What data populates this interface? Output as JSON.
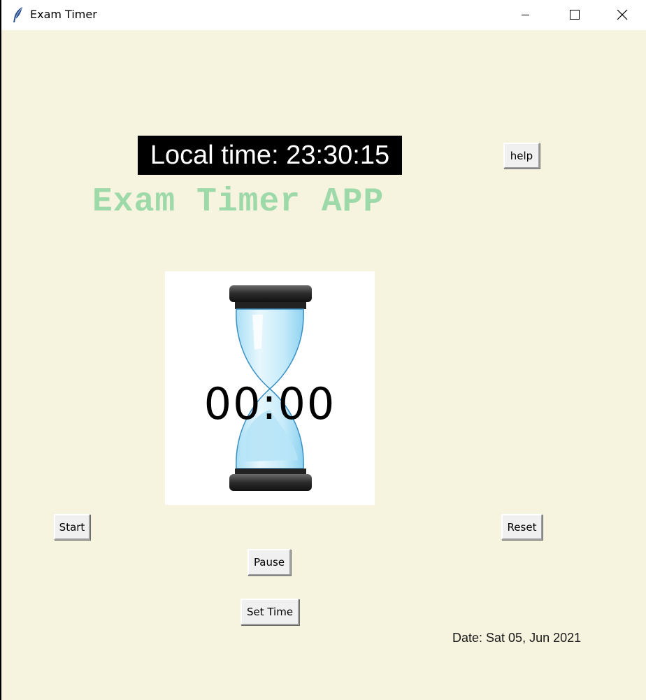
{
  "window": {
    "title": "Exam Timer",
    "icon": "feather-icon",
    "controls": [
      "minimize-icon",
      "maximize-icon",
      "close-icon"
    ]
  },
  "clock": {
    "text": "Local time: 23:30:15"
  },
  "app_title": "Exam Timer APP",
  "buttons": {
    "help": "help",
    "start": "Start",
    "reset": "Reset",
    "pause": "Pause",
    "set_time": "Set Time"
  },
  "timer": {
    "display": "00:00",
    "image": "hourglass-icon"
  },
  "date": "Date: Sat 05, Jun 2021",
  "colors": {
    "background": "#f6f3de",
    "title_green": "#9edaa9",
    "clock_bg": "#000000",
    "clock_fg": "#ffffff"
  }
}
